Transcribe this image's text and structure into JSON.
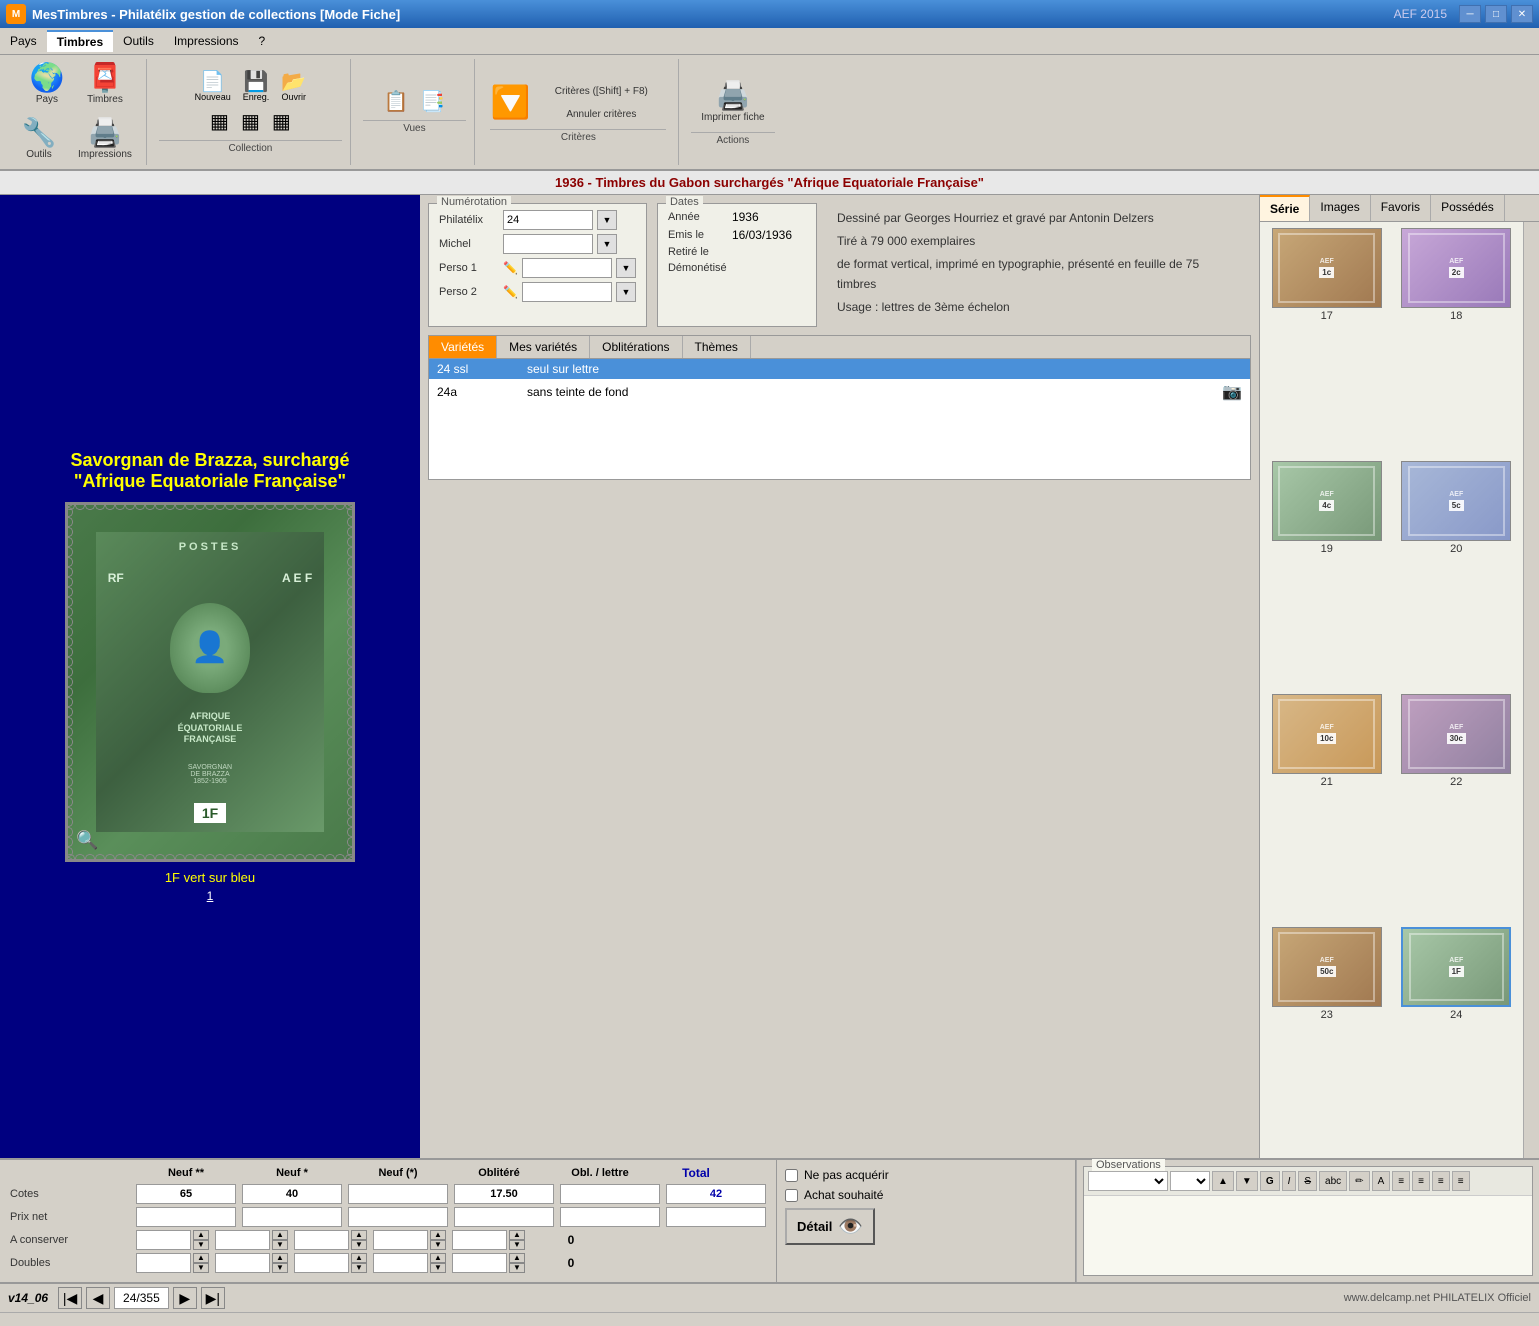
{
  "app": {
    "title": "MesTimbres - Philatélix gestion de collections [Mode Fiche]",
    "version_label": "AEF 2015",
    "website": "www.delcamp.net",
    "brand": "PHILATELIX Officiel"
  },
  "menu": {
    "items": [
      "Pays",
      "Timbres",
      "Outils",
      "Impressions",
      "?"
    ],
    "active": "Timbres"
  },
  "toolbar": {
    "groups": {
      "nav": {
        "label": "",
        "buttons": [
          {
            "id": "pays",
            "icon": "🌍",
            "label": "Pays"
          },
          {
            "id": "timbres",
            "icon": "📮",
            "label": "Timbres"
          },
          {
            "id": "outils",
            "icon": "🔧",
            "label": "Outils"
          },
          {
            "id": "impressions",
            "icon": "🖨️",
            "label": "Impressions"
          }
        ]
      },
      "collection": {
        "label": "Collection",
        "buttons": []
      },
      "vues": {
        "label": "Vues",
        "buttons": []
      },
      "criteres": {
        "main_btn": "Critères ([Shift] + F8)",
        "cancel_btn": "Annuler\ncritères",
        "label": "Critères"
      },
      "actions": {
        "print_btn": "Imprimer\nfiche",
        "label": "Actions"
      }
    }
  },
  "record": {
    "title": "1936 - Timbres du Gabon surchargés \"Afrique Equatoriale Française\"",
    "stamp_title_line1": "Savorgnan de Brazza, surchargé",
    "stamp_title_line2": "\"Afrique Equatoriale Française\"",
    "stamp_subtitle": "1F vert sur bleu",
    "stamp_number": "1",
    "description": {
      "line1": "Dessiné par Georges Hourriez et gravé par Antonin Delzers",
      "line2": "Tiré à 79 000 exemplaires",
      "line3": "de format vertical, imprimé en typographie, présenté en feuille de 75 timbres",
      "line4": "Usage : lettres de 3ème échelon"
    }
  },
  "numerotation": {
    "label": "Numérotation",
    "fields": [
      {
        "label": "Philatélix",
        "value": "24",
        "has_dropdown": true
      },
      {
        "label": "Michel",
        "value": "",
        "has_dropdown": true
      },
      {
        "label": "Perso 1",
        "value": "",
        "has_edit": true,
        "has_dropdown": true
      },
      {
        "label": "Perso 2",
        "value": "",
        "has_edit": true,
        "has_dropdown": true
      }
    ]
  },
  "dates": {
    "label": "Dates",
    "fields": [
      {
        "label": "Année",
        "value": "1936"
      },
      {
        "label": "Emis le",
        "value": "16/03/1936"
      },
      {
        "label": "Retiré le",
        "value": ""
      },
      {
        "label": "Démonétisé",
        "value": ""
      }
    ]
  },
  "varieties": {
    "tabs": [
      "Variétés",
      "Mes variétés",
      "Oblitérations",
      "Thèmes"
    ],
    "active_tab": "Variétés",
    "rows": [
      {
        "code": "24 ssl",
        "description": "seul sur lettre",
        "has_image": false,
        "selected": true
      },
      {
        "code": "24a",
        "description": "sans teinte de fond",
        "has_image": true,
        "selected": false
      }
    ]
  },
  "series_panel": {
    "tabs": [
      "Série",
      "Images",
      "Favoris",
      "Possédés"
    ],
    "active_tab": "Série",
    "thumbnails": [
      {
        "number": "17",
        "color_class": "brown"
      },
      {
        "number": "18",
        "color_class": "purple"
      },
      {
        "number": "19",
        "color_class": "green"
      },
      {
        "number": "20",
        "color_class": "blue-purple"
      },
      {
        "number": "21",
        "color_class": "orange"
      },
      {
        "number": "22",
        "color_class": "violet"
      },
      {
        "number": "23",
        "color_class": "brown"
      },
      {
        "number": "24",
        "color_class": "green",
        "selected": true
      }
    ]
  },
  "values": {
    "columns": [
      "Neuf **",
      "Neuf *",
      "Neuf (*)",
      "Oblitéré",
      "Obl. / lettre",
      "Total"
    ],
    "rows": [
      {
        "label": "Cotes",
        "values": [
          "65",
          "40",
          "",
          "17.50",
          "",
          "42"
        ],
        "filled": [
          true,
          true,
          false,
          true,
          false,
          true
        ]
      },
      {
        "label": "Prix net",
        "values": [
          "",
          "",
          "",
          "",
          "",
          ""
        ],
        "filled": [
          false,
          false,
          false,
          false,
          false,
          false
        ]
      },
      {
        "label": "A conserver",
        "values": [
          "",
          "",
          "",
          "",
          "",
          "0"
        ],
        "spinners": true
      },
      {
        "label": "Doubles",
        "values": [
          "",
          "",
          "",
          "",
          "",
          "0"
        ],
        "spinners": true
      }
    ]
  },
  "bottom_center": {
    "checkboxes": [
      {
        "label": "Ne pas acquérir",
        "checked": false
      },
      {
        "label": "Achat souhaité",
        "checked": false
      }
    ],
    "detail_btn": "Détail"
  },
  "observations": {
    "label": "Observations",
    "toolbar_items": [
      "dropdown1",
      "dropdown2",
      "up-arrow",
      "down-arrow",
      "G",
      "I",
      "S",
      "abc",
      "pencil",
      "A",
      "align-left",
      "align-center",
      "align-right",
      "align-justify"
    ]
  },
  "status": {
    "version": "v14_06",
    "current_record": "24",
    "total_records": "355",
    "website": "www.delcamp.net",
    "brand": "PHILATELIX Officiel"
  },
  "window_controls": {
    "minimize": "─",
    "maximize": "□",
    "close": "✕"
  }
}
